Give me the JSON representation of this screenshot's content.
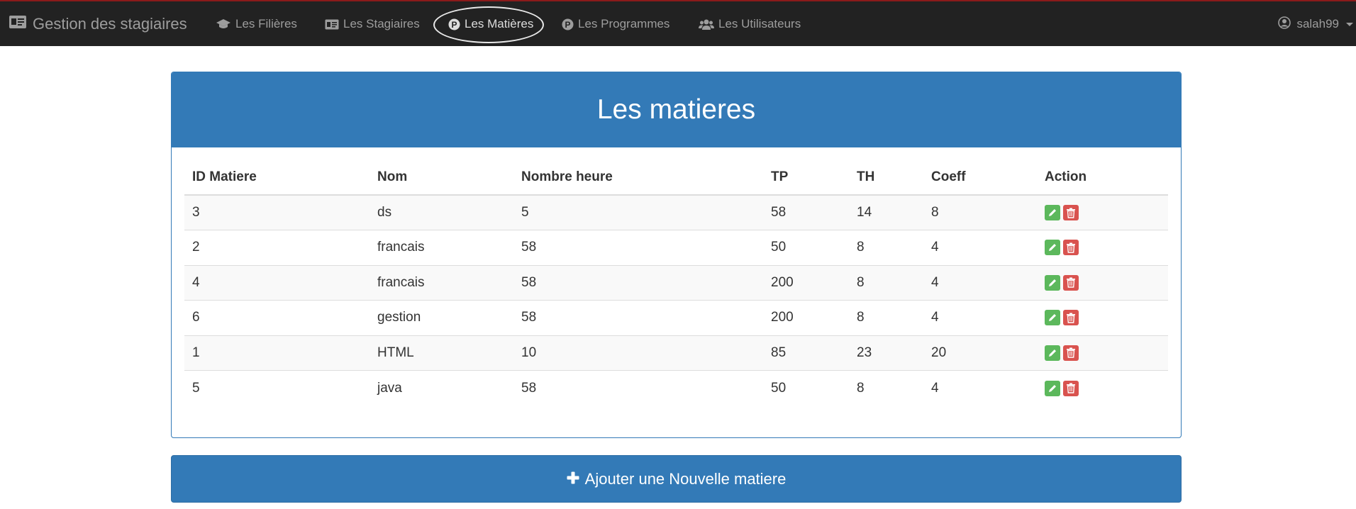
{
  "nav": {
    "brand": "Gestion des stagiaires",
    "brand_icon": "id-card-icon",
    "items": [
      {
        "label": "Les Filières",
        "icon": "graduation-cap-icon"
      },
      {
        "label": "Les Stagiaires",
        "icon": "id-card-icon"
      },
      {
        "label": "Les Matières",
        "icon": "p-circle-icon"
      },
      {
        "label": "Les Programmes",
        "icon": "p-circle-icon"
      },
      {
        "label": "Les Utilisateurs",
        "icon": "users-icon"
      }
    ],
    "user": "salah99"
  },
  "panel": {
    "title": "Les matieres",
    "headers": [
      "ID Matiere",
      "Nom",
      "Nombre heure",
      "TP",
      "TH",
      "Coeff",
      "Action"
    ],
    "rows": [
      [
        "3",
        "ds",
        "5",
        "58",
        "14",
        "8"
      ],
      [
        "2",
        "francais",
        "58",
        "50",
        "8",
        "4"
      ],
      [
        "4",
        "francais",
        "58",
        "200",
        "8",
        "4"
      ],
      [
        "6",
        "gestion",
        "58",
        "200",
        "8",
        "4"
      ],
      [
        "1",
        "HTML",
        "10",
        "85",
        "23",
        "20"
      ],
      [
        "5",
        "java",
        "58",
        "50",
        "8",
        "4"
      ]
    ]
  },
  "add_button": {
    "label": "Ajouter une Nouvelle matiere"
  },
  "colors": {
    "navbar": "#222222",
    "primary": "#337ab7",
    "success": "#5cb85c",
    "danger": "#d9534f"
  }
}
